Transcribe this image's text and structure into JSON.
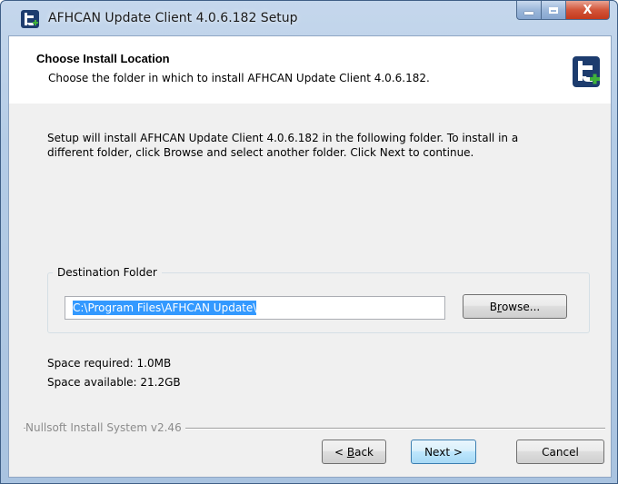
{
  "window": {
    "title": "AFHCAN Update Client 4.0.6.182 Setup",
    "app_icon": "afhcan-t-icon",
    "close_glyph": "X"
  },
  "header": {
    "title": "Choose Install Location",
    "subtitle": "Choose the folder in which to install AFHCAN Update Client 4.0.6.182.",
    "logo": "afhcan-t-logo-icon"
  },
  "body": {
    "intro_line1": "Setup will install AFHCAN Update Client 4.0.6.182 in the following folder. To install in a",
    "intro_line2": "different folder, click Browse and select another folder. Click Next to continue."
  },
  "destination": {
    "legend": "Destination Folder",
    "path": "C:\\Program Files\\AFHCAN Update\\",
    "browse_pre": "B",
    "browse_ul": "r",
    "browse_post": "owse..."
  },
  "space": {
    "required": "Space required: 1.0MB",
    "available": "Space available: 21.2GB"
  },
  "footer": {
    "brand": "Nullsoft Install System v2.46",
    "back_pre": "< ",
    "back_ul": "B",
    "back_post": "ack",
    "next_label": "Next >",
    "cancel_label": "Cancel"
  },
  "colors": {
    "selection": "#3399ff",
    "logo_navy": "#1d3c6e",
    "logo_green": "#3fb23a"
  }
}
